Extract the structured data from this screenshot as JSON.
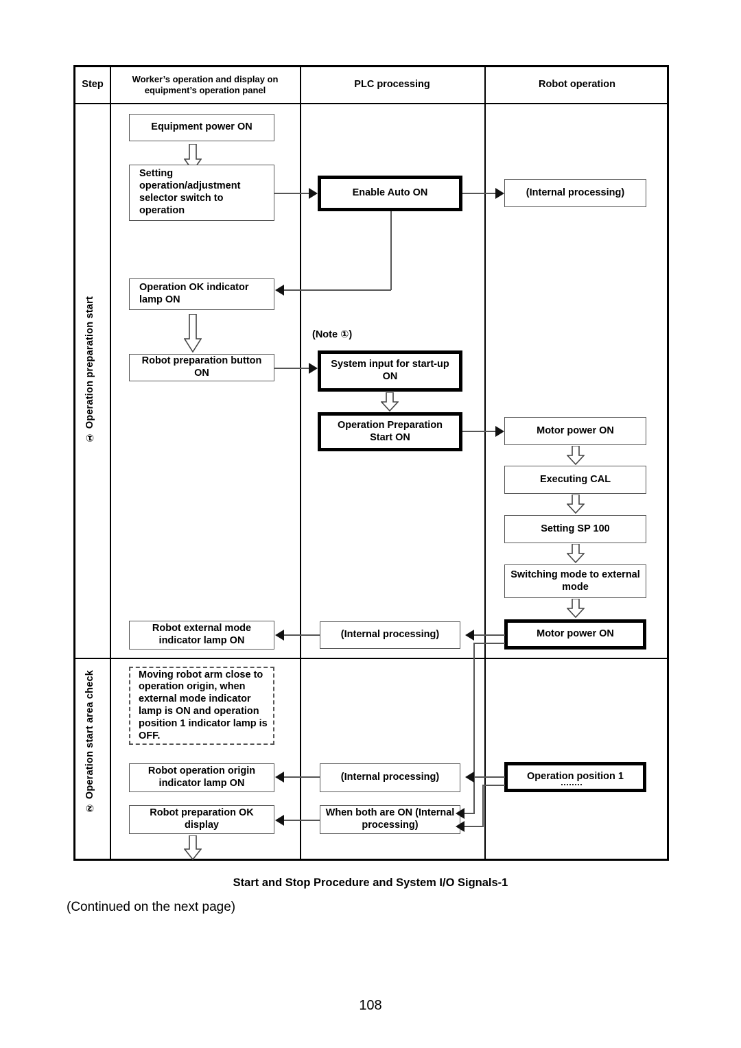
{
  "document": {
    "page_number": "108",
    "figure_caption": "Start and Stop Procedure and System I/O Signals-1",
    "continued_note": "(Continued on the next page)"
  },
  "table": {
    "headers": {
      "step": "Step",
      "worker": "Worker’s operation and display on equipment’s operation panel",
      "plc": "PLC processing",
      "robot": "Robot operation"
    },
    "steps": [
      {
        "id": "step-1",
        "label": "① Operation preparation start"
      },
      {
        "id": "step-2",
        "label": "② Operation start area check"
      }
    ]
  },
  "flow": {
    "note_label": "(Note ①)",
    "worker_column": [
      {
        "id": "equipment-power-on",
        "text": "Equipment power ON",
        "style": "thin"
      },
      {
        "id": "setting-selector-switch",
        "text": "Setting operation/adjustment selector switch to operation",
        "style": "thin"
      },
      {
        "id": "operation-ok-indicator-lamp-on",
        "text": "Operation OK indicator lamp ON",
        "style": "thin"
      },
      {
        "id": "robot-preparation-button-on",
        "text": "Robot preparation button ON",
        "style": "thin"
      },
      {
        "id": "robot-external-mode-indicator-lamp-on",
        "text": "Robot external mode indicator lamp ON",
        "style": "thin"
      },
      {
        "id": "moving-robot-arm-note",
        "text": "Moving robot arm close to operation origin, when external mode indicator lamp is ON and operation position 1 indicator lamp is OFF.",
        "style": "dashed"
      },
      {
        "id": "robot-operation-origin-indicator-lamp-on",
        "text": "Robot operation origin indicator lamp ON",
        "style": "thin"
      },
      {
        "id": "robot-preparation-ok-display",
        "text": "Robot preparation OK display",
        "style": "thin"
      }
    ],
    "plc_column": [
      {
        "id": "enable-auto-on",
        "text": "Enable Auto ON",
        "style": "thick"
      },
      {
        "id": "system-input-for-startup-on",
        "text": "System input for start-up ON",
        "style": "thick"
      },
      {
        "id": "operation-preparation-start-on",
        "text": "Operation Preparation Start ON",
        "style": "thick"
      },
      {
        "id": "plc-internal-processing-1",
        "text": "(Internal processing)",
        "style": "thin"
      },
      {
        "id": "plc-internal-processing-2",
        "text": "(Internal processing)",
        "style": "thin"
      },
      {
        "id": "when-both-are-on",
        "text": "When both are ON (Internal processing)",
        "style": "thin"
      }
    ],
    "robot_column": [
      {
        "id": "robot-internal-processing",
        "text": "(Internal processing)",
        "style": "thin"
      },
      {
        "id": "motor-power-on-1",
        "text": "Motor power ON",
        "style": "thin"
      },
      {
        "id": "executing-cal",
        "text": "Executing CAL",
        "style": "thin"
      },
      {
        "id": "setting-sp-100",
        "text": "Setting SP 100",
        "style": "thin"
      },
      {
        "id": "switching-mode-to-external-mode",
        "text": "Switching mode to external mode",
        "style": "thin"
      },
      {
        "id": "motor-power-on-2",
        "text": "Motor power ON",
        "style": "thick"
      },
      {
        "id": "operation-position-1",
        "text": "Operation position 1",
        "style": "thick"
      }
    ]
  },
  "colors": {
    "ink": "#000000",
    "line": "#555555",
    "paper": "#ffffff"
  }
}
